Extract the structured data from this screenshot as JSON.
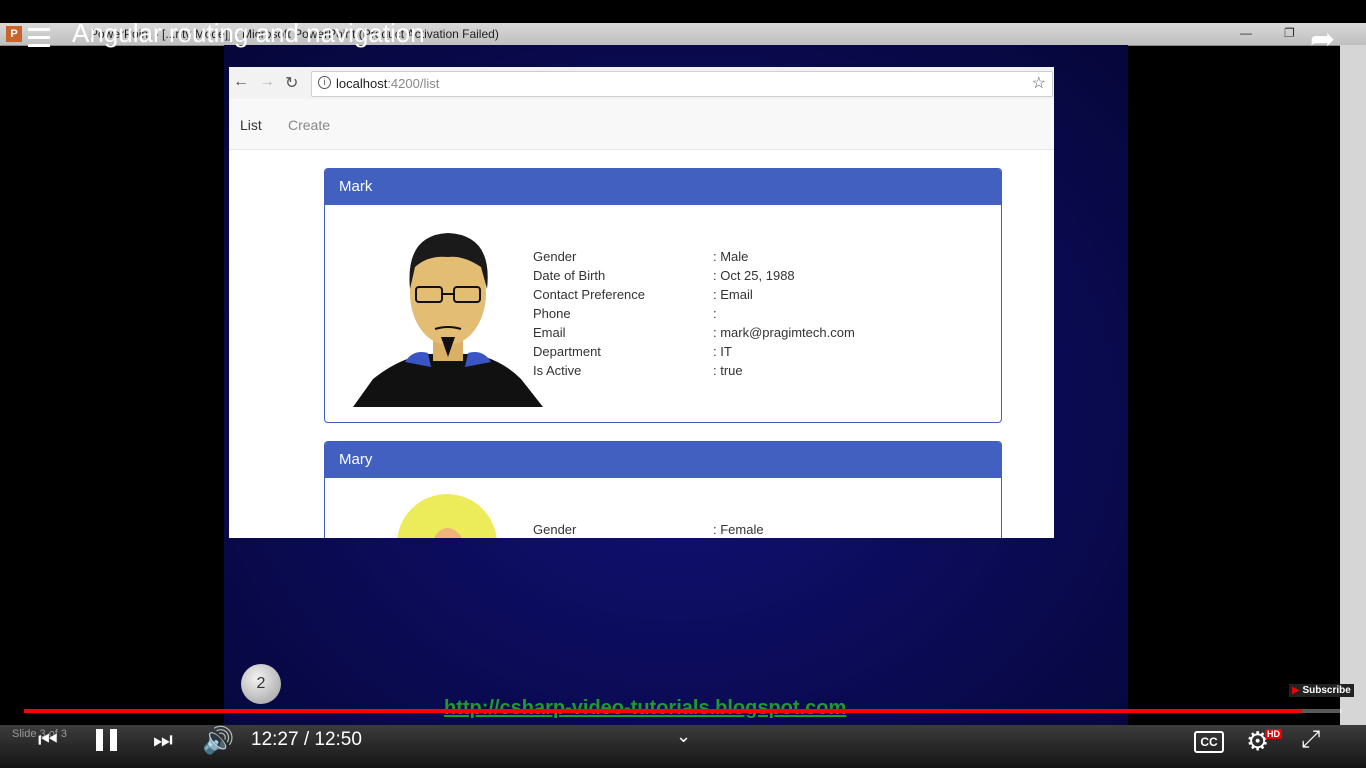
{
  "powerpoint": {
    "app_icon": "P",
    "window_title": "PowerPoint - [...rity Mode]] - Microsoft PowerPoint (Product Activation Failed)",
    "status_text": "Slide 3 of 3"
  },
  "browser": {
    "url_host": "localhost",
    "url_path": ":4200/list"
  },
  "app_nav": {
    "list_label": "List",
    "create_label": "Create"
  },
  "employees": [
    {
      "name": "Mark",
      "rows": [
        {
          "label": "Gender",
          "value": ": Male"
        },
        {
          "label": "Date of Birth",
          "value": ": Oct 25, 1988"
        },
        {
          "label": "Contact Preference",
          "value": ": Email"
        },
        {
          "label": "Phone",
          "value": ":"
        },
        {
          "label": "Email",
          "value": ": mark@pragimtech.com"
        },
        {
          "label": "Department",
          "value": ": IT"
        },
        {
          "label": "Is Active",
          "value": ": true"
        }
      ]
    },
    {
      "name": "Mary",
      "rows": [
        {
          "label": "Gender",
          "value": ": Female"
        }
      ]
    }
  ],
  "slide": {
    "slide_number": "2",
    "blog_url": "http://csharp-video-tutorials.blogspot.com"
  },
  "youtube": {
    "video_title": "Angular routing and navigation",
    "current_time": "12:27",
    "duration": "12:50",
    "time_display": "12:27 / 12:50",
    "progress_fraction": 0.97,
    "subscribe_label": "Subscribe",
    "subscribe_logo": "▶",
    "cc_label": "CC",
    "hd_badge": "HD"
  },
  "colors": {
    "card_header": "#4160c0",
    "progress": "#ff0000",
    "blog_link": "#1f9a2b"
  }
}
